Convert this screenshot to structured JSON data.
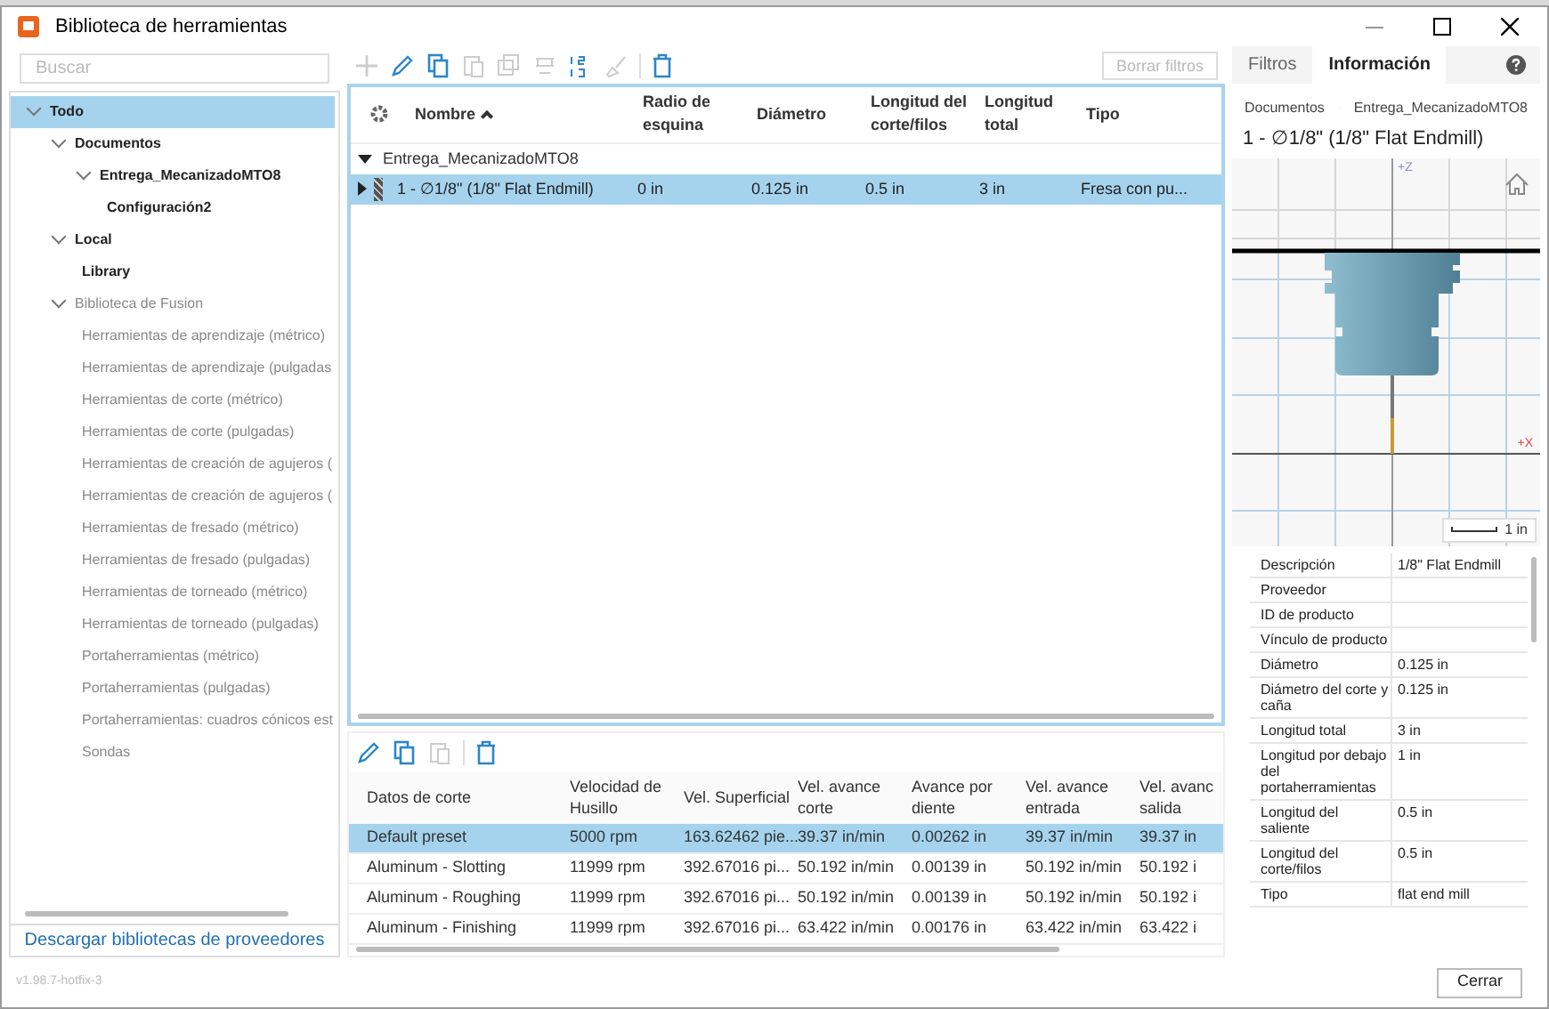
{
  "window": {
    "title": "Biblioteca de herramientas"
  },
  "search": {
    "placeholder": "Buscar"
  },
  "tree": [
    {
      "label": "Todo",
      "selected": true,
      "expanded": true,
      "dimmed": false,
      "children": [
        {
          "label": "Documentos",
          "selected": false,
          "expanded": true,
          "dimmed": false,
          "children": [
            {
              "label": "Entrega_MecanizadoMTO8",
              "selected": false,
              "expanded": true,
              "dimmed": false,
              "children": [
                {
                  "label": "Configuración2",
                  "selected": false,
                  "dimmed": false
                }
              ]
            }
          ]
        },
        {
          "label": "Local",
          "selected": false,
          "expanded": true,
          "dimmed": false,
          "children": [
            {
              "label": "Library",
              "selected": false,
              "dimmed": false
            }
          ]
        },
        {
          "label": "Biblioteca de Fusion",
          "selected": false,
          "expanded": true,
          "dimmed": true,
          "children": [
            {
              "label": "Herramientas de aprendizaje (métrico)",
              "selected": false,
              "dimmed": true
            },
            {
              "label": "Herramientas de aprendizaje (pulgadas",
              "selected": false,
              "dimmed": true
            },
            {
              "label": "Herramientas de corte (métrico)",
              "selected": false,
              "dimmed": true
            },
            {
              "label": "Herramientas de corte (pulgadas)",
              "selected": false,
              "dimmed": true
            },
            {
              "label": "Herramientas de creación de agujeros (",
              "selected": false,
              "dimmed": true
            },
            {
              "label": "Herramientas de creación de agujeros (",
              "selected": false,
              "dimmed": true
            },
            {
              "label": "Herramientas de fresado (métrico)",
              "selected": false,
              "dimmed": true
            },
            {
              "label": "Herramientas de fresado (pulgadas)",
              "selected": false,
              "dimmed": true
            },
            {
              "label": "Herramientas de torneado (métrico)",
              "selected": false,
              "dimmed": true
            },
            {
              "label": "Herramientas de torneado (pulgadas)",
              "selected": false,
              "dimmed": true
            },
            {
              "label": "Portaherramientas (métrico)",
              "selected": false,
              "dimmed": true
            },
            {
              "label": "Portaherramientas (pulgadas)",
              "selected": false,
              "dimmed": true
            },
            {
              "label": "Portaherramientas: cuadros cónicos est",
              "selected": false,
              "dimmed": true
            },
            {
              "label": "Sondas",
              "selected": false,
              "dimmed": true
            }
          ]
        }
      ]
    }
  ],
  "vendor_link": "Descargar bibliotecas de proveedores",
  "version": "v1.98.7-hotfix-3",
  "clear_filters": "Borrar filtros",
  "tools_table": {
    "columns": [
      "Nombre",
      "Radio de esquina",
      "Diámetro",
      "Longitud del corte/filos",
      "Longitud total",
      "Tipo"
    ],
    "groups": [
      {
        "label": "Entrega_MecanizadoMTO8",
        "expanded": true,
        "rows": [
          {
            "selected": true,
            "cells": [
              "1 - ∅1/8\" (1/8\" Flat Endmill)",
              "0 in",
              "0.125 in",
              "0.5 in",
              "3 in",
              "Fresa con pu..."
            ]
          }
        ]
      }
    ]
  },
  "presets_table": {
    "columns": [
      "Datos de corte",
      "Velocidad de Husillo",
      "Vel. Superficial",
      "Vel. avance corte",
      "Avance por diente",
      "Vel. avance entrada",
      "Vel. avanc salida"
    ],
    "rows": [
      {
        "selected": true,
        "cells": [
          "Default preset",
          "5000 rpm",
          "163.62462 pie...",
          "39.37 in/min",
          "0.00262 in",
          "39.37 in/min",
          "39.37 in"
        ]
      },
      {
        "selected": false,
        "cells": [
          "Aluminum - Slotting",
          "11999 rpm",
          "392.67016 pi...",
          "50.192 in/min",
          "0.00139 in",
          "50.192 in/min",
          "50.192 i"
        ]
      },
      {
        "selected": false,
        "cells": [
          "Aluminum - Roughing",
          "11999 rpm",
          "392.67016 pi...",
          "50.192 in/min",
          "0.00139 in",
          "50.192 in/min",
          "50.192 i"
        ]
      },
      {
        "selected": false,
        "cells": [
          "Aluminum - Finishing",
          "11999 rpm",
          "392.67016 pi...",
          "63.422 in/min",
          "0.00176 in",
          "63.422 in/min",
          "63.422 i"
        ]
      }
    ]
  },
  "info_panel": {
    "tabs": [
      {
        "label": "Filtros",
        "selected": false
      },
      {
        "label": "Información",
        "selected": true
      }
    ],
    "breadcrumb": [
      "Documentos",
      "Entrega_MecanizadoMTO8"
    ],
    "tool_title": "1 - ∅1/8\" (1/8\" Flat Endmill)",
    "axis_z": "+Z",
    "axis_x": "+X",
    "scale_label": "1 in",
    "properties": [
      {
        "label": "Descripción",
        "value": "1/8\" Flat Endmill"
      },
      {
        "label": "Proveedor"
      },
      {
        "label": "ID de producto"
      },
      {
        "label": "Vínculo de producto"
      },
      {
        "label": "Diámetro",
        "value": "0.125 in"
      },
      {
        "label": "Diámetro del corte y caña",
        "value": "0.125 in"
      },
      {
        "label": "Longitud total",
        "value": "3 in"
      },
      {
        "label": "Longitud por debajo del portaherramientas",
        "value": "1 in"
      },
      {
        "label": "Longitud del saliente",
        "value": "0.5 in"
      },
      {
        "label": "Longitud del corte/filos",
        "value": "0.5 in"
      },
      {
        "label": "Tipo",
        "value": "flat end mill"
      }
    ]
  },
  "close_button": "Cerrar"
}
